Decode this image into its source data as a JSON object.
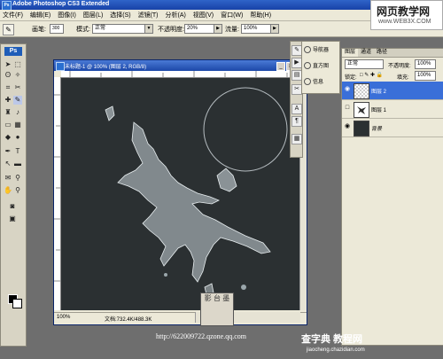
{
  "app": {
    "title": "Adobe Photoshop CS3 Extended",
    "icon": "ps-icon"
  },
  "menu": [
    "文件(F)",
    "编辑(E)",
    "图像(I)",
    "图层(L)",
    "选择(S)",
    "滤镜(T)",
    "分析(A)",
    "视图(V)",
    "窗口(W)",
    "帮助(H)"
  ],
  "options": {
    "brush_label": "画笔:",
    "brush_size": "300",
    "mode_label": "模式:",
    "mode_value": "正常",
    "opacity_label": "不透明度:",
    "opacity_value": "20%",
    "flow_label": "流量:",
    "flow_value": "100%"
  },
  "watermark_top": {
    "line1": "网页教学网",
    "line2": "www.WEB3X.COM"
  },
  "toolbox": {
    "logo": "Ps"
  },
  "document": {
    "title": "未标题-1 @ 100% (图层 2, RGB/8)",
    "zoom": "100%",
    "doc_size": "文档:732.4K/488.3K",
    "stamp_text": "影 台 墨"
  },
  "mini_panel": [
    {
      "label": "导航器",
      "icon": "navigator-icon"
    },
    {
      "label": "直方图",
      "icon": "histogram-icon"
    },
    {
      "label": "信息",
      "icon": "info-icon"
    }
  ],
  "layers_panel": {
    "tabs": [
      "图层",
      "通道",
      "路径"
    ],
    "blend_mode": "正常",
    "opacity_label": "不透明度:",
    "opacity_value": "100%",
    "lock_label": "锁定:",
    "fill_label": "填充:",
    "fill_value": "100%",
    "layers": [
      {
        "name": "图层 2",
        "selected": true
      },
      {
        "name": "图层 1",
        "selected": false
      },
      {
        "name": "背景",
        "selected": false
      }
    ]
  },
  "footer": {
    "url": "http://622009722.qzone.qq.com",
    "watermark": "查字典 教程网",
    "watermark_url": "jiaocheng.chazidian.com"
  }
}
